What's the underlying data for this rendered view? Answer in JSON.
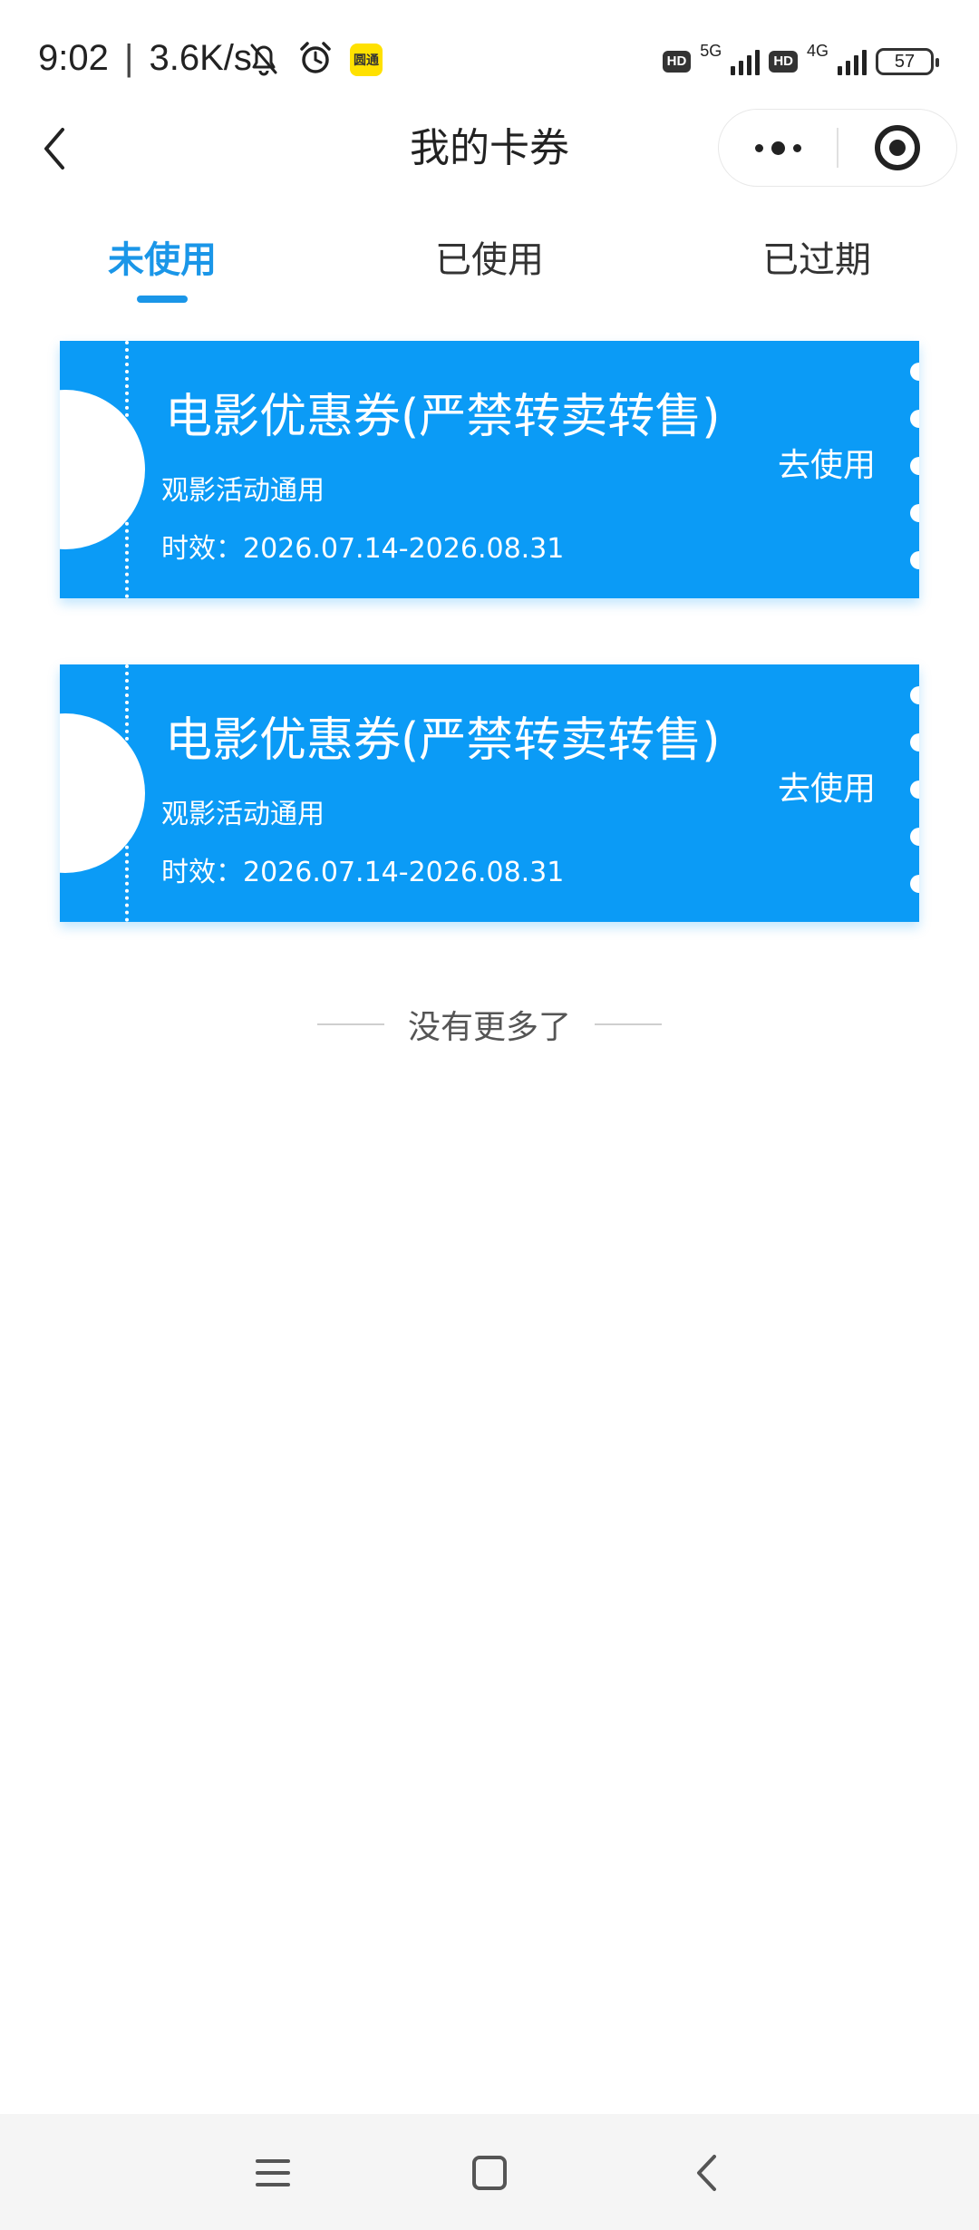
{
  "status_bar": {
    "time": "9:02",
    "speed": "3.6K/s",
    "icons_left": [
      "mute-bell-icon",
      "alarm-icon",
      "app-badge-icon"
    ],
    "app_badge_text": "圆通",
    "hd_label": "HD",
    "net1": "5G",
    "net2": "4G",
    "battery": "57"
  },
  "nav": {
    "title": "我的卡券",
    "back_icon": "chevron-left-icon",
    "more_icon": "more-dots-icon",
    "close_icon": "target-circle-icon"
  },
  "tabs": [
    {
      "label": "未使用",
      "active": true
    },
    {
      "label": "已使用",
      "active": false
    },
    {
      "label": "已过期",
      "active": false
    }
  ],
  "coupons": [
    {
      "title": "电影优惠券(严禁转卖转售)",
      "desc": "观影活动通用",
      "validity": "时效：2026.07.14-2026.08.31",
      "action": "去使用"
    },
    {
      "title": "电影优惠券(严禁转卖转售)",
      "desc": "观影活动通用",
      "validity": "时效：2026.07.14-2026.08.31",
      "action": "去使用"
    }
  ],
  "list_end": "没有更多了",
  "colors": {
    "accent": "#1a96e8",
    "coupon_bg": "#0b9bf6"
  }
}
